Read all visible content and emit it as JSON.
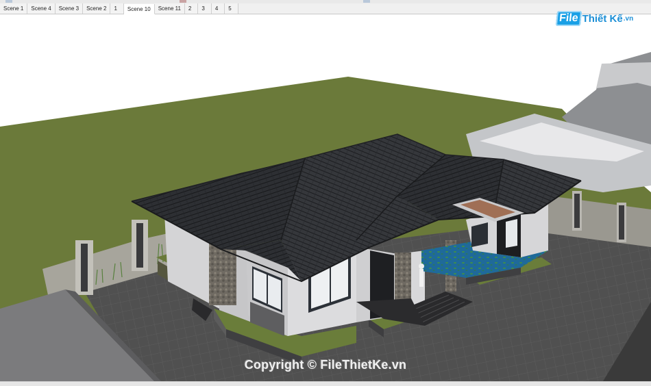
{
  "tabs": [
    {
      "label": "Scene 1",
      "active": false
    },
    {
      "label": "Scene 4",
      "active": false
    },
    {
      "label": "Scene 3",
      "active": false
    },
    {
      "label": "Scene 2",
      "active": false
    },
    {
      "label": "1",
      "active": false
    },
    {
      "label": "Scene 10",
      "active": true
    },
    {
      "label": "Scene 11",
      "active": false
    },
    {
      "label": "2",
      "active": false
    },
    {
      "label": "3",
      "active": false
    },
    {
      "label": "4",
      "active": false
    },
    {
      "label": "5",
      "active": false
    }
  ],
  "watermark": {
    "logo_file": "File",
    "logo_rest": "Thiết Kế",
    "logo_tld": ".vn",
    "copyright": "Copyright © FileThietKe.vn"
  },
  "colors": {
    "grass": "#6b7a3a",
    "roof": "#2b2d31",
    "paving": "#4c4c4c",
    "wall": "#d6d6d8",
    "pool": "#1f6a9a"
  }
}
